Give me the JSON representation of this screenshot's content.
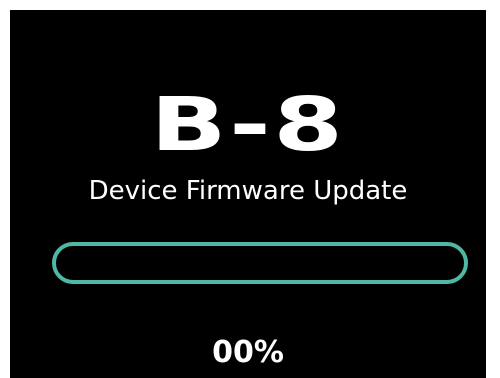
{
  "screen": {
    "device_name": "B-8",
    "subtitle": "Device Firmware Update",
    "progress_text": "00%",
    "progress_value": 0,
    "accent_color": "#4fb7a6",
    "background_color": "#000000"
  }
}
